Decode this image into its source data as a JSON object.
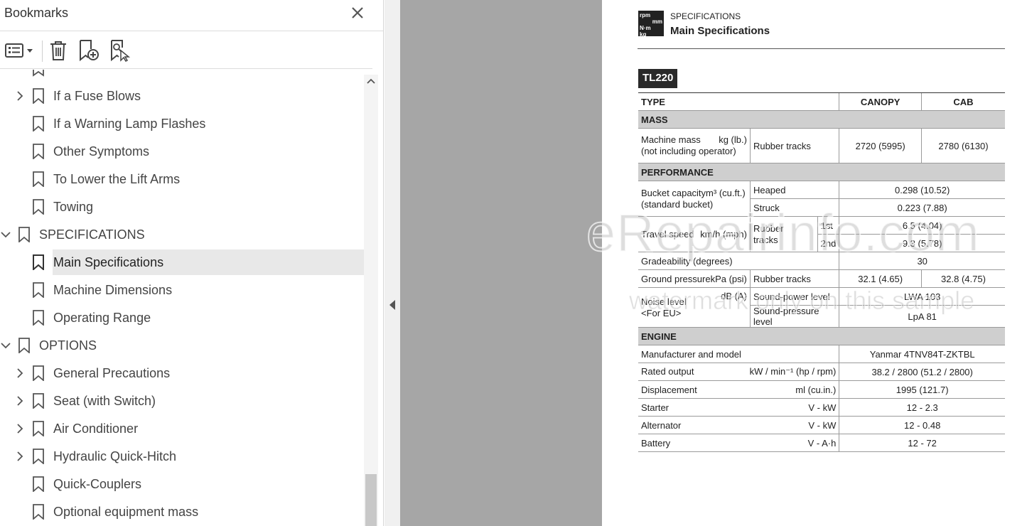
{
  "bookmarks_panel": {
    "title": "Bookmarks",
    "toolbar": {
      "options_icon": "list-options-icon",
      "delete_icon": "trash-icon",
      "new_bookmark_icon": "add-bookmark-icon",
      "find_icon": "find-bookmark-icon"
    },
    "items": [
      {
        "label": "If a Fuse Blows",
        "expandable": true
      },
      {
        "label": "If a Warning Lamp Flashes",
        "expandable": false
      },
      {
        "label": "Other Symptoms",
        "expandable": false
      },
      {
        "label": "To Lower the Lift Arms",
        "expandable": false
      },
      {
        "label": "Towing",
        "expandable": false
      },
      {
        "label": "SPECIFICATIONS",
        "expandable": true,
        "expanded": true
      },
      {
        "label": "Main Specifications",
        "expandable": false,
        "selected": true
      },
      {
        "label": "Machine Dimensions",
        "expandable": false
      },
      {
        "label": "Operating Range",
        "expandable": false
      },
      {
        "label": "OPTIONS",
        "expandable": true,
        "expanded": true
      },
      {
        "label": "General Precautions",
        "expandable": true
      },
      {
        "label": "Seat (with Switch)",
        "expandable": true
      },
      {
        "label": "Air Conditioner",
        "expandable": true
      },
      {
        "label": "Hydraulic Quick-Hitch",
        "expandable": true
      },
      {
        "label": "Quick-Couplers",
        "expandable": false
      },
      {
        "label": "Optional equipment mass",
        "expandable": false
      }
    ]
  },
  "document": {
    "icon_text": [
      "rpm",
      "mm",
      "N·m",
      "kg"
    ],
    "section": "SPECIFICATIONS",
    "title": "Main Specifications",
    "model": "TL220",
    "table": {
      "type_label": "TYPE",
      "col_canopy": "CANOPY",
      "col_cab": "CAB",
      "mass_section": "MASS",
      "machine_mass_label": "Machine mass",
      "machine_mass_units": "kg (lb.)",
      "machine_mass_note": "(not including operator)",
      "rubber_tracks": "Rubber tracks",
      "mass_canopy": "2720 (5995)",
      "mass_cab": "2780 (6130)",
      "performance_section": "PERFORMANCE",
      "bucket_label": "Bucket capacity",
      "bucket_units": "m³ (cu.ft.)",
      "bucket_note": "(standard bucket)",
      "heaped": "Heaped",
      "heaped_val": "0.298 (10.52)",
      "struck": "Struck",
      "struck_val": "0.223 (7.88)",
      "travel_label": "Travel speed",
      "travel_units": "km/h (mph)",
      "rubber": "Rubber",
      "tracks": "tracks",
      "first": "1st",
      "first_val": "6.5 (4.04)",
      "second": "2nd",
      "second_val": "9.3 (5.78)",
      "grade_label": "Gradeability (degrees)",
      "grade_val": "30",
      "ground_label": "Ground pressure",
      "ground_units": "kPa (psi)",
      "ground_canopy": "32.1 (4.65)",
      "ground_cab": "32.8 (4.75)",
      "noise_label": "Noise level",
      "noise_note": "<For EU>",
      "noise_units": "dB (A)",
      "sound_power": "Sound-power level",
      "sound_power_val": "LWA 103",
      "sound_pressure": "Sound-pressure level",
      "sound_pressure_val": "LpA 81",
      "engine_section": "ENGINE",
      "manufacturer_label": "Manufacturer and model",
      "manufacturer_val": "Yanmar 4TNV84T-ZKTBL",
      "rated_label": "Rated output",
      "rated_units": "kW / min⁻¹ (hp / rpm)",
      "rated_val": "38.2 / 2800 (51.2 / 2800)",
      "disp_label": "Displacement",
      "disp_units": "ml (cu.in.)",
      "disp_val": "1995 (121.7)",
      "starter_label": "Starter",
      "starter_units": "V - kW",
      "starter_val": "12 - 2.3",
      "alternator_label": "Alternator",
      "alternator_units": "V - kW",
      "alternator_val": "12 - 0.48",
      "battery_label": "Battery",
      "battery_units": "V - A·h",
      "battery_val": "12 - 72"
    }
  },
  "watermark": {
    "line1": "eRepairinfo.com",
    "line2": "watermark only on this sample"
  }
}
